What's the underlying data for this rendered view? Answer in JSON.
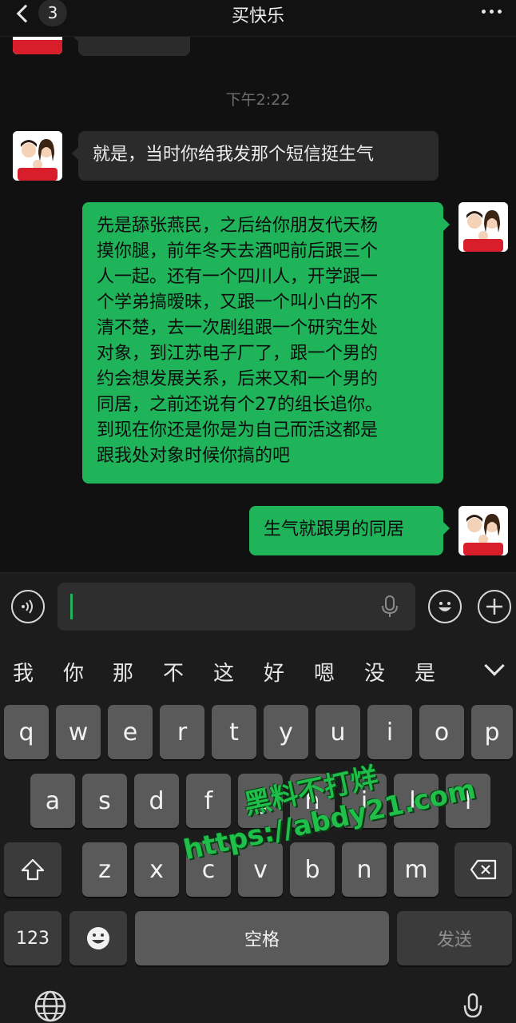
{
  "header": {
    "back_count": "3",
    "title": "买快乐"
  },
  "messages": {
    "time_divider": "下午2:22",
    "m1": "就是，当时你给我发那个短信挺生气",
    "m2_lines": [
      "先是舔张燕民，之后给你朋友代天杨",
      "摸你腿，前年冬天去酒吧前后跟三个",
      "人一起。还有一个四川人，开学跟一",
      "个学弟搞暧昧，又跟一个叫小白的不",
      "清不楚，去一次剧组跟一个研究生处",
      "对象，到江苏电子厂了，跟一个男的",
      "约会想发展关系，后来又和一个男的",
      "同居，之前还说有个27的组长追你。",
      "到现在你还是你是为自己而活这都是",
      "跟我处对象时候你搞的吧"
    ],
    "m3": "生气就跟男的同居"
  },
  "candidates": [
    "我",
    "你",
    "那",
    "不",
    "这",
    "好",
    "嗯",
    "没",
    "是"
  ],
  "keyboard": {
    "row1": [
      "q",
      "w",
      "e",
      "r",
      "t",
      "y",
      "u",
      "i",
      "o",
      "p"
    ],
    "row2": [
      "a",
      "s",
      "d",
      "f",
      "g",
      "h",
      "j",
      "k",
      "l"
    ],
    "row3": [
      "z",
      "x",
      "c",
      "v",
      "b",
      "n",
      "m"
    ],
    "num_key": "123",
    "space_key": "空格",
    "send_key": "发送"
  },
  "watermark": {
    "line1": "黑料不打烊",
    "line2": "https://abdy21.com"
  },
  "colors": {
    "sent_bubble": "#1fb35a",
    "received_bubble": "#2b2b2b",
    "background": "#111111"
  },
  "icons": [
    "back-chevron-icon",
    "more-icon",
    "voice-icon",
    "microphone-icon",
    "emoji-icon",
    "plus-icon",
    "shift-icon",
    "backspace-icon",
    "globe-icon",
    "dictation-icon"
  ]
}
